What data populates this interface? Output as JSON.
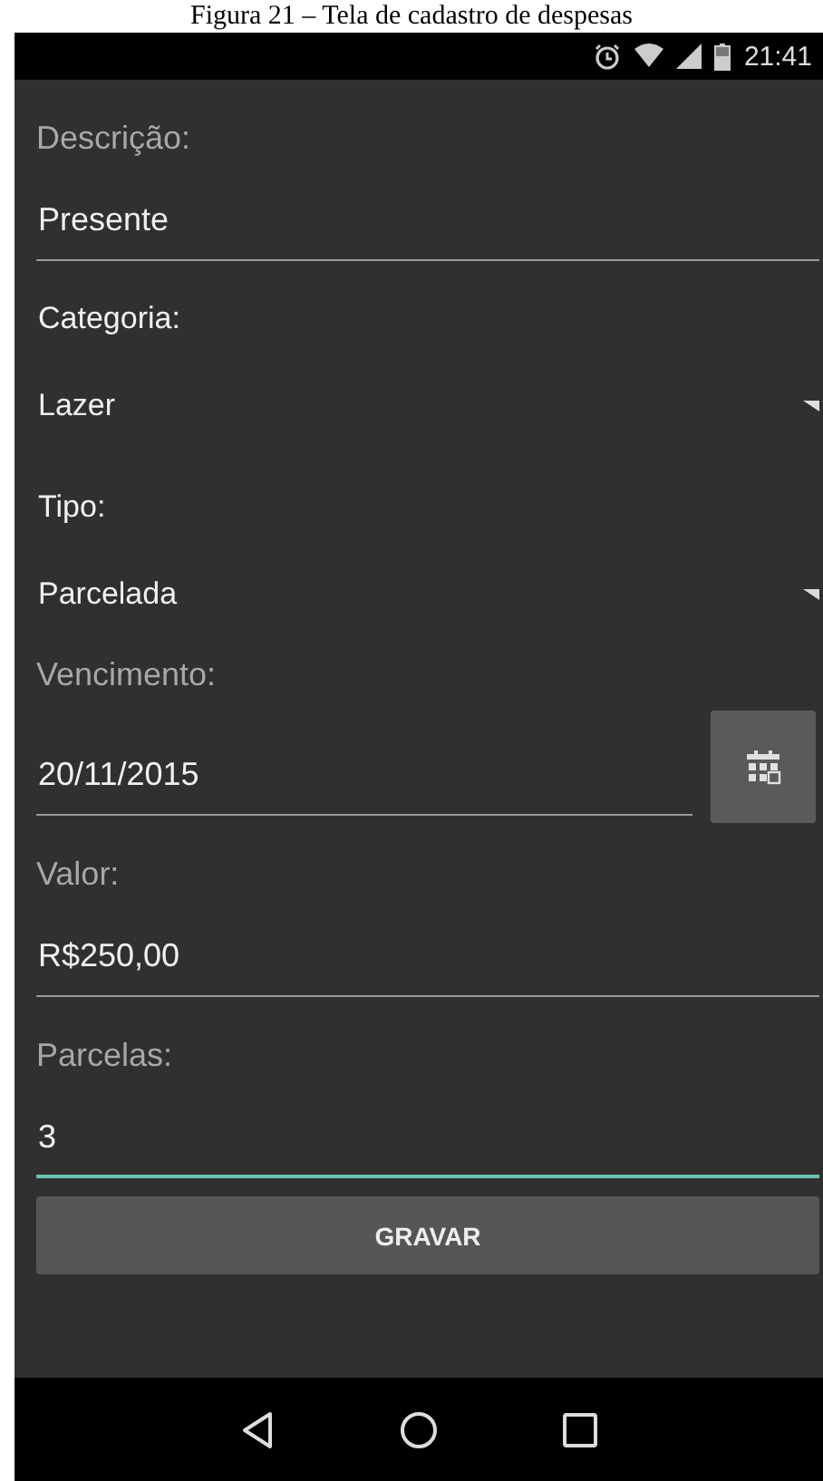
{
  "caption": "Figura 21 – Tela de cadastro de despesas",
  "status_bar": {
    "time": "21:41"
  },
  "fields": [
    {
      "kind": "text",
      "label": "Descrição:",
      "value": "Presente",
      "focused": false
    },
    {
      "kind": "spinner",
      "label": "Categoria:",
      "value": "Lazer"
    },
    {
      "kind": "spinner",
      "label": "Tipo:",
      "value": "Parcelada"
    },
    {
      "kind": "date",
      "label": "Vencimento:",
      "value": "20/11/2015"
    },
    {
      "kind": "text",
      "label": "Valor:",
      "value": "R$250,00",
      "focused": false
    },
    {
      "kind": "text",
      "label": "Parcelas:",
      "value": "3",
      "focused": true
    }
  ],
  "button": "GRAVAR"
}
